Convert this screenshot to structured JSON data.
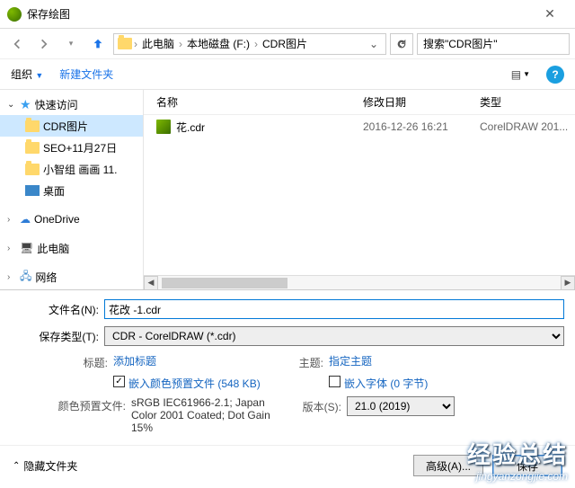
{
  "title": "保存绘图",
  "breadcrumb": {
    "seg1": "此电脑",
    "seg2": "本地磁盘 (F:)",
    "seg3": "CDR图片"
  },
  "search_placeholder": "搜索\"CDR图片\"",
  "toolbar": {
    "organize": "组织",
    "newfolder": "新建文件夹"
  },
  "tree": {
    "quick": "快速访问",
    "items": [
      {
        "label": "CDR图片"
      },
      {
        "label": "SEO+11月27日"
      },
      {
        "label": "小智组 画画 11."
      },
      {
        "label": "桌面"
      }
    ],
    "onedrive": "OneDrive",
    "thispc": "此电脑",
    "network": "网络"
  },
  "columns": {
    "name": "名称",
    "date": "修改日期",
    "type": "类型"
  },
  "file": {
    "name": "花.cdr",
    "date": "2016-12-26 16:21",
    "type": "CorelDRAW 201..."
  },
  "filename_label": "文件名(N):",
  "filename_value": "花改 -1.cdr",
  "filetype_label": "保存类型(T):",
  "filetype_value": "CDR - CorelDRAW (*.cdr)",
  "tag_label": "标题:",
  "tag_value": "添加标题",
  "subject_label": "主题:",
  "subject_value": "指定主题",
  "embed_color": "嵌入颜色预置文件 (548 KB)",
  "embed_font": "嵌入字体 (0 字节)",
  "version_label": "版本(S):",
  "version_value": "21.0 (2019)",
  "profile_label": "颜色预置文件:",
  "profile_value": "sRGB IEC61966-2.1; Japan Color 2001 Coated; Dot Gain 15%",
  "hide_folders": "隐藏文件夹",
  "advanced": "高级(A)...",
  "save": "保存",
  "watermark_zh": "经验总结",
  "watermark_py": "jingyanzongjie.com"
}
